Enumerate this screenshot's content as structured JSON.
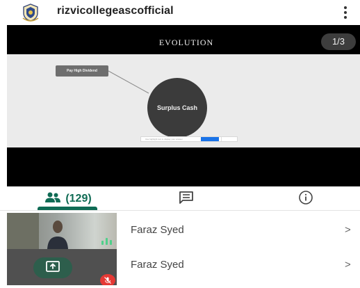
{
  "header": {
    "account_name": "rizvicollegeascofficial",
    "logo_icon": "college-crest-icon",
    "menu_icon": "more-vert-icon"
  },
  "stage": {
    "slide_title": "EVOLUTION",
    "page_indicator": "1/3",
    "slide": {
      "small_node_label": "Pay High Dividend",
      "big_node_label": "Surplus Cash",
      "toolbar_hint": "Use highlight tool to display your answer"
    }
  },
  "tabs": {
    "people_count": "(129)",
    "people_icon": "people-icon",
    "chat_icon": "chat-icon",
    "info_icon": "info-icon",
    "accent_color": "#0f6b54"
  },
  "participants": [
    {
      "name": "Faraz Syed",
      "chevron": ">"
    },
    {
      "name": "Faraz Syed",
      "chevron": ">"
    }
  ],
  "self_tile": {
    "share_icon": "present-screen-icon",
    "mute_icon": "mic-off-icon",
    "mute_color": "#e53935"
  }
}
